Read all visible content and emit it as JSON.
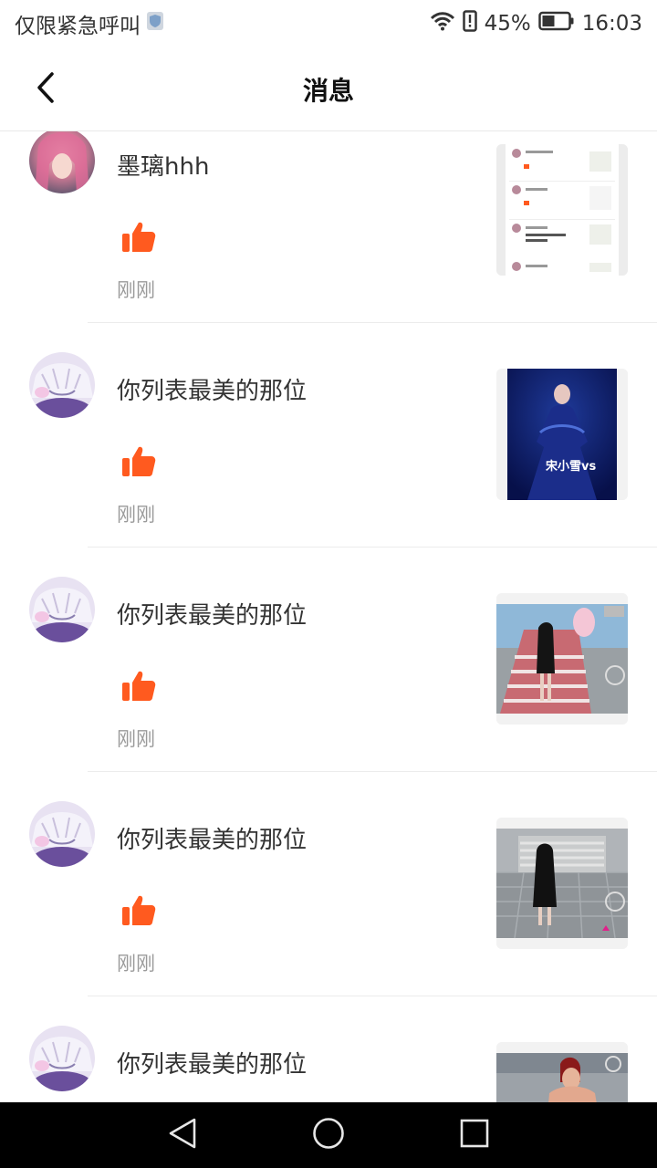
{
  "status_bar": {
    "left_text": "仅限紧急呼叫",
    "battery_percent": "45%",
    "time": "16:03",
    "icons": [
      "shield-icon",
      "wifi-icon",
      "alert-icon",
      "battery-icon"
    ]
  },
  "header": {
    "title": "消息",
    "back_icon": "back-arrow-icon"
  },
  "messages": [
    {
      "name": "墨璃hhh",
      "time": "刚刚",
      "like_icon": "thumbs-up-icon",
      "thumb_type": "screenshot-comments"
    },
    {
      "name": "你列表最美的那位",
      "time": "刚刚",
      "like_icon": "thumbs-up-icon",
      "thumb_type": "video-cover",
      "thumb_overlay": "宋小雪vs"
    },
    {
      "name": "你列表最美的那位",
      "time": "刚刚",
      "like_icon": "thumbs-up-icon",
      "thumb_type": "game-stairs-red"
    },
    {
      "name": "你列表最美的那位",
      "time": "刚刚",
      "like_icon": "thumbs-up-icon",
      "thumb_type": "game-stairs-gray"
    },
    {
      "name": "你列表最美的那位",
      "time": "",
      "like_icon": "thumbs-up-icon",
      "thumb_type": "game-character"
    }
  ],
  "colors": {
    "accent": "#ff5a1f",
    "time_text": "#9a9a9a",
    "nav_bg": "#000000"
  }
}
